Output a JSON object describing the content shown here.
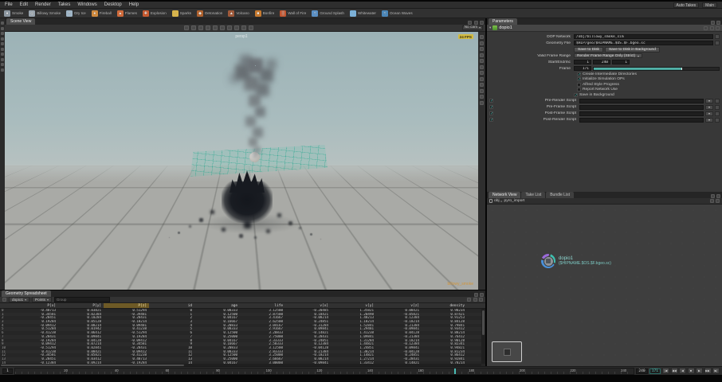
{
  "menubar": {
    "items": [
      "File",
      "Edit",
      "Render",
      "Takes",
      "Windows",
      "Desktop",
      "Help"
    ],
    "auto_takes": "Auto Takes",
    "take": "Main"
  },
  "shelf": {
    "tools": [
      {
        "label": "Smoke",
        "glyph": "●",
        "color": "#8d98a2"
      },
      {
        "label": "Billowy Smoke",
        "glyph": "◎",
        "color": "#9aa5af"
      },
      {
        "label": "Dry Ice",
        "glyph": "≈",
        "color": "#9fb5c6"
      },
      {
        "label": "Fireball",
        "glyph": "●",
        "color": "#d08a3e"
      },
      {
        "label": "Flames",
        "glyph": "▲",
        "color": "#d06a3a"
      },
      {
        "label": "Explosion",
        "glyph": "✚",
        "color": "#c85a30"
      },
      {
        "label": "Sparks",
        "glyph": "∴",
        "color": "#d8b44a"
      },
      {
        "label": "Detonation",
        "glyph": "◆",
        "color": "#b0622e"
      },
      {
        "label": "Volcano",
        "glyph": "▲",
        "color": "#a05a3a"
      },
      {
        "label": "Bonfire",
        "glyph": "■",
        "color": "#c87a2e"
      },
      {
        "label": "Wall of Fire",
        "glyph": "▒",
        "color": "#c4552e"
      },
      {
        "label": "Ground Splash",
        "glyph": "≈",
        "color": "#5a8fc4"
      },
      {
        "label": "Whitewater",
        "glyph": "∴",
        "color": "#7ab0d8"
      },
      {
        "label": "Ocean Waves",
        "glyph": "≈",
        "color": "#4a86b8"
      }
    ]
  },
  "left_toolbar": {
    "icons": [
      "select",
      "translate",
      "rotate",
      "scale",
      "handles",
      "snap",
      "pose",
      "lasso",
      "paint",
      "history"
    ]
  },
  "viewport": {
    "pane_tab": "Scene View",
    "view_label": "persp1",
    "camera_menu": "No cam",
    "fps_badge": "24 FPS",
    "context_label": "billowy_smoke",
    "toolbar_icons": [
      "select-mode",
      "move-mode",
      "rotate-mode",
      "scale-mode",
      "snap-toggle",
      "grid-toggle",
      "shade-mode",
      "wireframe-mode",
      "lighting-mode",
      "camera-view"
    ],
    "right_toolbar_icons": [
      "home-view",
      "frame-all",
      "camera-lock",
      "grid",
      "ruler",
      "shade",
      "wire",
      "normals",
      "points",
      "hdr",
      "perf",
      "help"
    ]
  },
  "params": {
    "pane_tabs": [
      "Parameters"
    ],
    "node_name": "dopio1",
    "dopnet_label": "DOP Network",
    "dopnet_value": "/obj/billowy_smoke_sim",
    "file_label": "Geometry File",
    "file_value": "$HIP/geo/$HIPNAME.$OS.$F.bgeo.sc",
    "save_buttons": [
      "Save to Disk",
      "Save to Disk in Background"
    ],
    "range_label": "Valid Frame Range",
    "range_value": "Render Frame Range Only (Strict)",
    "frames_label": "Start/End/Inc",
    "frames": [
      "1",
      "240",
      "1"
    ],
    "frame_label": "Frame",
    "frame_value": "171",
    "frame_fill_pct": 71,
    "checks": [
      {
        "label": "Create Intermediate Directories",
        "checked": true
      },
      {
        "label": "Initialize Simulation OPs",
        "checked": true
      },
      {
        "label": "Alfred Style Progress",
        "checked": false
      },
      {
        "label": "Report Network Use",
        "checked": false
      }
    ],
    "bg_check": {
      "label": "Save in Background",
      "checked": true
    },
    "scripts": [
      {
        "label": "Pre-Render Script",
        "value": ""
      },
      {
        "label": "Pre-Frame Script",
        "value": ""
      },
      {
        "label": "Post-Frame Script",
        "value": ""
      },
      {
        "label": "Post-Render Script",
        "value": ""
      }
    ]
  },
  "network": {
    "pane_tabs": [
      "Network View",
      "Take List",
      "Bundle List"
    ],
    "breadcrumb": [
      "obj",
      "pyro_import"
    ],
    "node": {
      "name": "dopio1",
      "file_label": "($HIPNAME.$OS.$F.bgeo.sc)"
    }
  },
  "spreadsheet": {
    "pane_tabs": [
      "Geometry Spreadsheet"
    ],
    "node_path": "dopio1",
    "class_selector": "Points",
    "group_placeholder": "Group",
    "highlight_col": 3,
    "columns": [
      "",
      "P[x]",
      "P[y]",
      "P[z]",
      "id",
      "age",
      "life",
      "v[x]",
      "v[y]",
      "v[z]",
      "density"
    ],
    "rows": [
      [
        "0",
        "-0.48713",
        "0.03821",
        "0.51294",
        "0",
        "0.08333",
        "3.12500",
        "-0.20485",
        "1.35821",
        "0.08421",
        "0.98234"
      ],
      [
        "1",
        "0.34581",
        "0.02384",
        "-0.39481",
        "1",
        "0.12500",
        "2.87500",
        "0.18421",
        "1.20498",
        "-0.05821",
        "0.87421"
      ],
      [
        "2",
        "-0.28451",
        "0.10284",
        "0.28431",
        "2",
        "0.04167",
        "3.41667",
        "-0.08214",
        "1.48213",
        "0.12384",
        "0.91253"
      ],
      [
        "3",
        "0.19284",
        "0.05128",
        "-0.18214",
        "3",
        "0.16667",
        "2.62500",
        "0.24851",
        "1.18214",
        "-0.18214",
        "0.84128"
      ],
      [
        "4",
        "-0.09412",
        "0.08214",
        "0.09481",
        "4",
        "0.20833",
        "3.04167",
        "-0.31284",
        "1.52841",
        "0.21384",
        "0.79841"
      ],
      [
        "5",
        "0.51284",
        "0.01942",
        "0.41238",
        "5",
        "0.08333",
        "2.91667",
        "0.09841",
        "1.29481",
        "-0.09841",
        "0.93412"
      ],
      [
        "6",
        "-0.41238",
        "0.06412",
        "-0.51294",
        "6",
        "0.12500",
        "3.20833",
        "-0.14821",
        "1.41238",
        "0.04128",
        "0.88214"
      ],
      [
        "7",
        "0.28431",
        "0.09841",
        "0.19284",
        "7",
        "0.25000",
        "2.75000",
        "0.28431",
        "1.09841",
        "-0.21384",
        "0.76412"
      ],
      [
        "8",
        "-0.19284",
        "0.04128",
        "-0.09412",
        "8",
        "0.04167",
        "3.33333",
        "-0.24851",
        "1.31284",
        "0.18214",
        "0.90128"
      ],
      [
        "9",
        "0.09412",
        "0.07214",
        "0.34581",
        "9",
        "0.16667",
        "2.58333",
        "0.12384",
        "1.44821",
        "-0.12384",
        "0.82341"
      ],
      [
        "10",
        "-0.51294",
        "0.02841",
        "-0.28431",
        "10",
        "0.20833",
        "3.12500",
        "-0.04128",
        "1.24851",
        "0.09841",
        "0.94821"
      ],
      [
        "11",
        "0.41238",
        "0.08421",
        "0.09412",
        "11",
        "0.08333",
        "2.83333",
        "0.21384",
        "1.38214",
        "-0.04128",
        "0.81234"
      ],
      [
        "12",
        "-0.34581",
        "0.05821",
        "-0.41238",
        "12",
        "0.12500",
        "3.25000",
        "-0.18214",
        "1.14821",
        "0.24851",
        "0.86412"
      ],
      [
        "13",
        "0.28451",
        "0.03412",
        "0.48713",
        "13",
        "0.25000",
        "2.66667",
        "0.08214",
        "1.27214",
        "-0.28431",
        "0.92841"
      ],
      [
        "14",
        "-0.12384",
        "0.09214",
        "-0.19284",
        "14",
        "0.04167",
        "3.00000",
        "-0.09841",
        "1.33412",
        "0.14821",
        "0.78214"
      ]
    ]
  },
  "playbar": {
    "start": "1",
    "end": "240",
    "frame": "171",
    "marker_pct": 71,
    "ticks": [
      "20",
      "40",
      "60",
      "80",
      "100",
      "120",
      "140",
      "160",
      "180",
      "200",
      "220",
      "240"
    ],
    "transport": [
      "|◀",
      "◀◀",
      "◀",
      "■",
      "▶",
      "▶▶",
      "▶|"
    ]
  },
  "colors": {
    "accent_teal": "#49bdb4",
    "node_label": "#8fd8d2",
    "badge_yellow": "#d3bd43",
    "warning_orange": "#d2953a"
  }
}
